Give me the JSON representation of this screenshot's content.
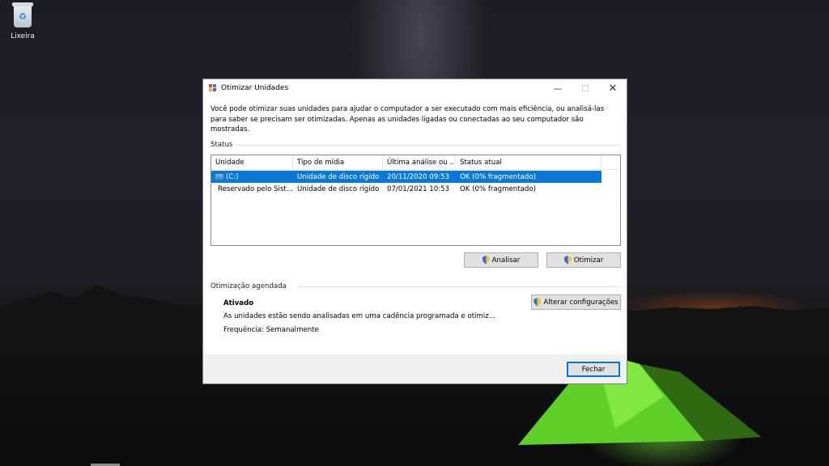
{
  "desktop": {
    "recycle_bin_label": "Lixeira"
  },
  "window": {
    "title": "Otimizar Unidades",
    "controls": {
      "minimize": "—",
      "maximize": "☐",
      "close": "✕"
    },
    "description": "Você pode otimizar suas unidades para ajudar o computador a ser executado com mais eficiência, ou analisá-las para saber se precisam ser otimizadas. Apenas as unidades ligadas ou conectadas ao seu computador são mostradas.",
    "status_section": {
      "label": "Status",
      "columns": [
        "Unidade",
        "Tipo de mídia",
        "Última análise ou ...",
        "Status atual"
      ],
      "rows": [
        {
          "drive": "(C:)",
          "media": "Unidade de disco rígido",
          "last": "20/11/2020 09:53",
          "status": "OK (0% fragmentado)",
          "selected": true,
          "icon": "drive-c-icon"
        },
        {
          "drive": "Reservado pelo Sist...",
          "media": "Unidade de disco rígido",
          "last": "07/01/2021 10:53",
          "status": "OK (0% fragmentado)",
          "selected": false,
          "icon": "drive-icon"
        }
      ],
      "analyze_button": "Analisar",
      "optimize_button": "Otimizar"
    },
    "schedule_section": {
      "label": "Otimização agendada",
      "state": "Ativado",
      "detail": "As unidades estão sendo analisadas em uma cadência programada e otimiz...",
      "frequency": "Frequência: Semanalmente",
      "change_settings_button": "Alterar configurações"
    },
    "close_button": "Fechar"
  },
  "colors": {
    "selection": "#0a78d7",
    "accent": "#0078d7"
  }
}
